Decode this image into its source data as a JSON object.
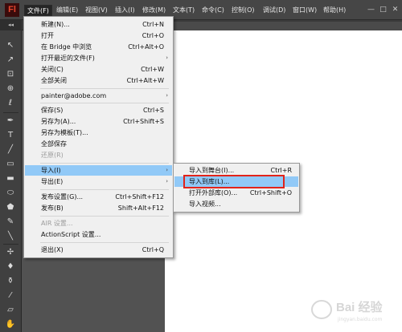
{
  "app": {
    "logo": "Fl"
  },
  "menubar": {
    "items": [
      {
        "label": "文件(F)",
        "active": true
      },
      {
        "label": "编辑(E)"
      },
      {
        "label": "视图(V)"
      },
      {
        "label": "插入(I)"
      },
      {
        "label": "修改(M)"
      },
      {
        "label": "文本(T)"
      },
      {
        "label": "命令(C)"
      },
      {
        "label": "控制(O)"
      },
      {
        "label": "调试(D)"
      },
      {
        "label": "窗口(W)"
      },
      {
        "label": "帮助(H)"
      }
    ],
    "window_buttons": [
      "—",
      "□",
      "✕"
    ]
  },
  "docbar": {
    "collapse_label": "◂◂"
  },
  "file_menu": {
    "items": [
      {
        "label": "新建(N)...",
        "shortcut": "Ctrl+N"
      },
      {
        "label": "打开",
        "shortcut": "Ctrl+O"
      },
      {
        "label": "在 Bridge 中浏览",
        "shortcut": "Ctrl+Alt+O"
      },
      {
        "label": "打开最近的文件(F)",
        "shortcut": "",
        "submenu": true
      },
      {
        "label": "关闭(C)",
        "shortcut": "Ctrl+W"
      },
      {
        "label": "全部关闭",
        "shortcut": "Ctrl+Alt+W"
      },
      {
        "label": "painter@adobe.com",
        "shortcut": "",
        "submenu": true
      },
      {
        "label": "保存(S)",
        "shortcut": "Ctrl+S"
      },
      {
        "label": "另存为(A)...",
        "shortcut": "Ctrl+Shift+S"
      },
      {
        "label": "另存为模板(T)...",
        "shortcut": ""
      },
      {
        "label": "全部保存",
        "shortcut": ""
      },
      {
        "label": "还原(R)",
        "shortcut": "",
        "disabled": true
      },
      {
        "label": "导入(I)",
        "shortcut": "",
        "submenu": true,
        "highlighted": true
      },
      {
        "label": "导出(E)",
        "shortcut": "",
        "submenu": true
      },
      {
        "label": "发布设置(G)...",
        "shortcut": "Ctrl+Shift+F12"
      },
      {
        "label": "发布(B)",
        "shortcut": "Shift+Alt+F12"
      },
      {
        "label": "AIR 设置...",
        "shortcut": "",
        "disabled": true
      },
      {
        "label": "ActionScript 设置...",
        "shortcut": ""
      },
      {
        "label": "退出(X)",
        "shortcut": "Ctrl+Q"
      }
    ]
  },
  "import_submenu": {
    "items": [
      {
        "label": "导入到舞台(I)...",
        "shortcut": "Ctrl+R"
      },
      {
        "label": "导入到库(L)...",
        "shortcut": "",
        "highlighted": true
      },
      {
        "label": "打开外部库(O)...",
        "shortcut": "Ctrl+Shift+O"
      },
      {
        "label": "导入视频...",
        "shortcut": ""
      }
    ]
  },
  "watermark": {
    "text": "Bai 经验",
    "sub": "jingyan.baidu.com"
  },
  "colors": {
    "highlight": "#91c9f7",
    "menubar": "#464646",
    "callout": "#e2231a"
  }
}
